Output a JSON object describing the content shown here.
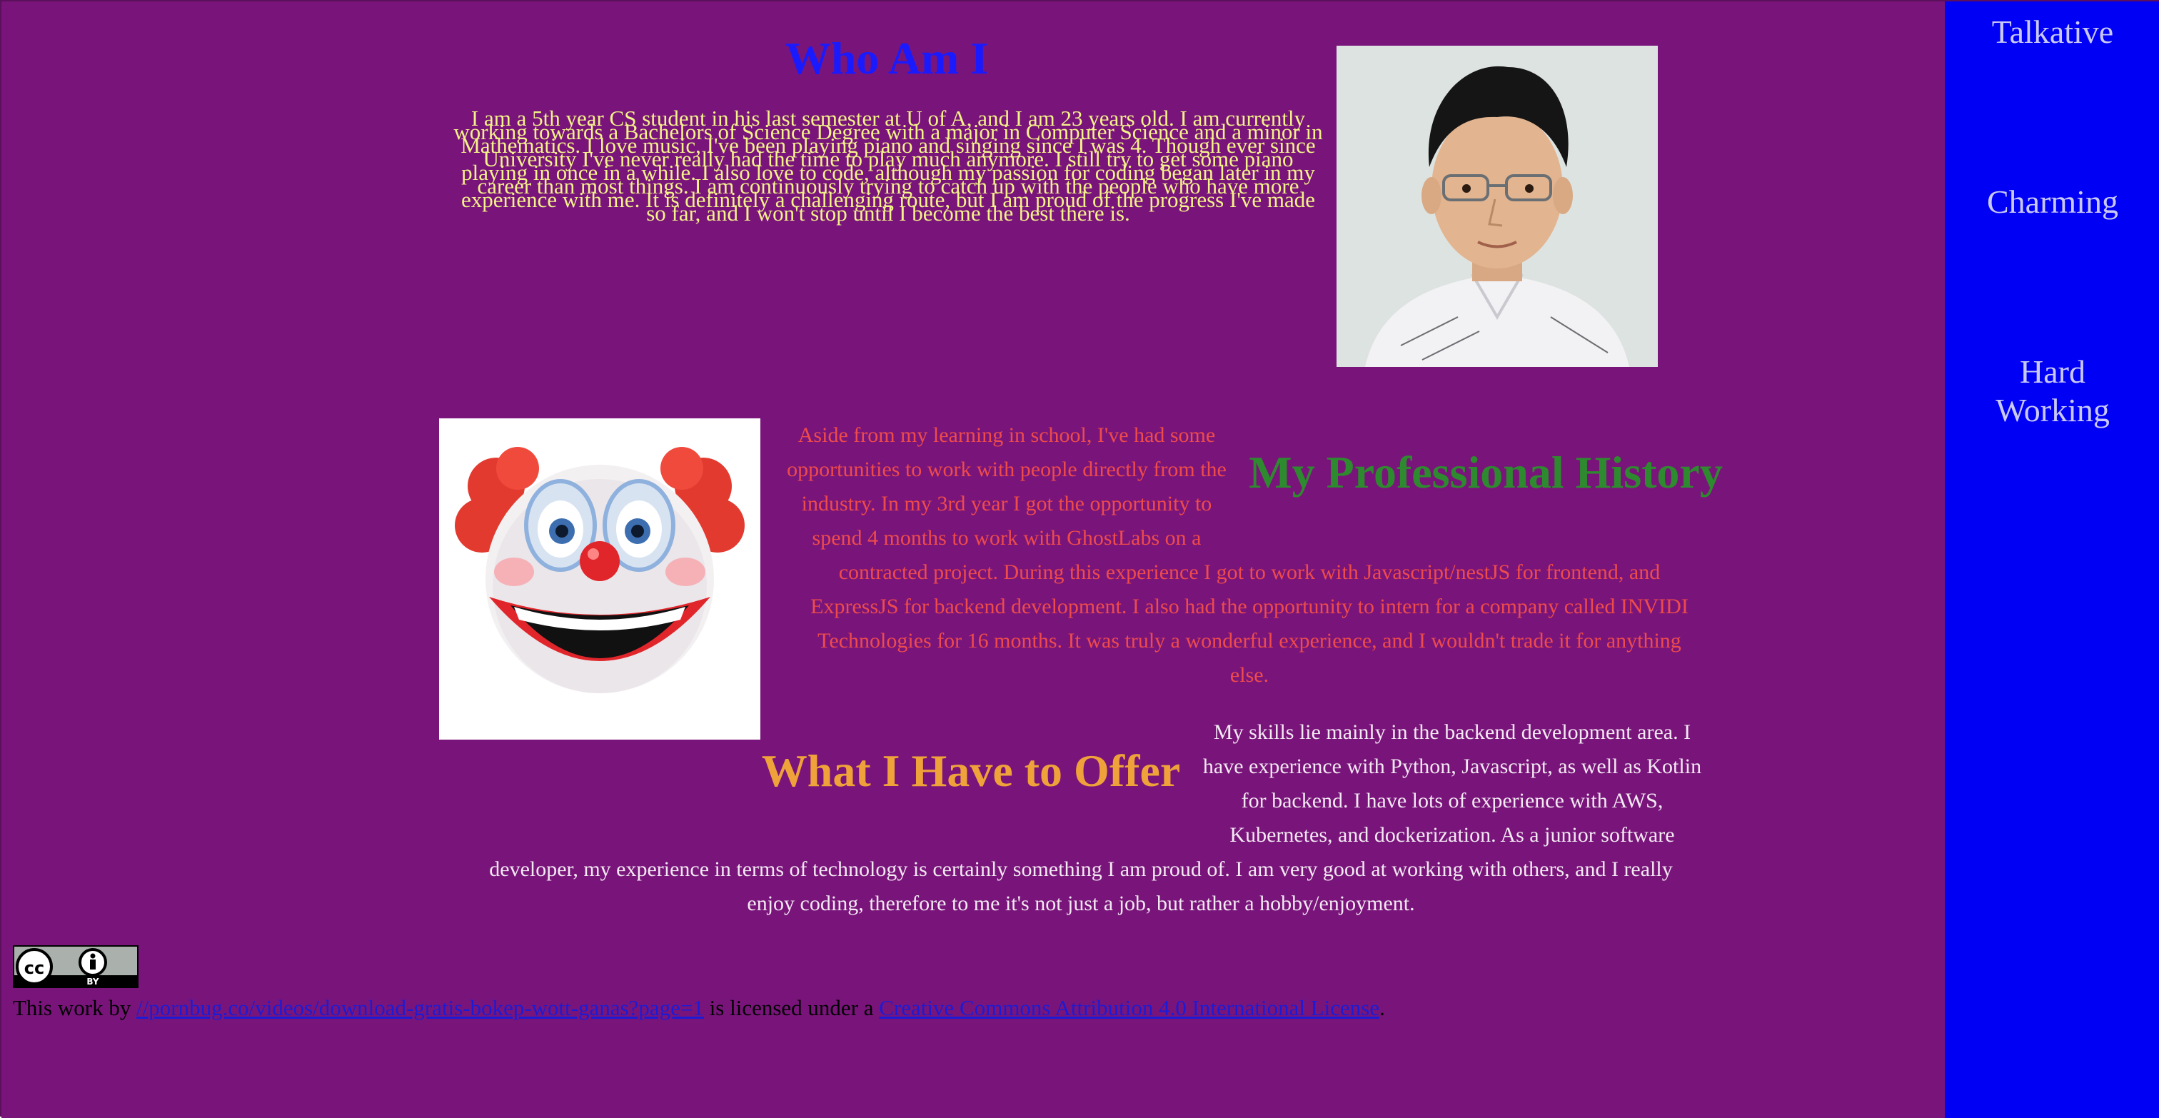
{
  "who_am_i": {
    "title": "Who Am I",
    "paragraph": "I am a 5th year CS student in his last semester at U of A, and I am 23 years old. I am currently working towards a Bachelors of Science Degree with a major in Computer Science and a minor in Mathematics. I love music, I've been playing piano and singing since I was 4. Though ever since University I've never really had the time to play much anymore. I still try to get some piano playing in once in a while. I also love to code, although my passion for coding began later in my career than most things. I am continuously trying to catch up with the people who have more experience with me. It is definitely a challenging route, but I am proud of the progress I've made so far, and I won't stop until I become the best there is.",
    "lines": [
      "I am a 5th year CS student in his last semester at U of A, and I am 23 years old. I am currently",
      "working towards a Bachelors of Science Degree with a major in Computer Science and a minor in",
      "Mathematics. I love music, I've been playing piano and singing since I was 4. Though ever since",
      "University I've never really had the time to play much anymore. I still try to get some piano",
      "playing in once in a while. I also love to code, although my passion for coding began later in my",
      "career than most things. I am continuously trying to catch up with the people who have more",
      "experience with me. It is definitely a challenging route, but I am proud of the progress I've made",
      "so far, and I won't stop until I become the best there is."
    ]
  },
  "professional_history": {
    "title": "My Professional History",
    "lines": [
      "Aside from my learning in school, I've had some",
      "opportunities to work with people directly from the",
      "industry. In my 3rd year I got the opportunity to",
      "spend 4 months to work with GhostLabs on a",
      "contracted project. During this experience I got to work with Javascript/nestJS for frontend, and",
      "ExpressJS for backend development. I also had the opportunity to intern for a company called INVIDI",
      "Technologies for 16 months. It was truly a wonderful experience, and I wouldn't trade it for anything",
      "else."
    ]
  },
  "offer": {
    "title": "What I Have to Offer",
    "lines": [
      "My skills lie mainly in the backend development area. I",
      "have experience with Python, Javascript, as well as Kotlin",
      "for backend. I have lots of experience with AWS,",
      "Kubernetes, and dockerization. As a junior software",
      "developer, my experience in terms of technology is certainly something I am proud of. I am very good at working with others, and I really",
      "enjoy coding, therefore to me it's not just a job, but rather a hobby/enjoyment."
    ]
  },
  "sidebar": {
    "items": [
      {
        "label": "Talkative"
      },
      {
        "label": "Charming"
      },
      {
        "label": "Hard Working",
        "line1": "Hard",
        "line2": "Working"
      }
    ]
  },
  "footer": {
    "badge_icon": "cc-by-icon",
    "badge_text": "BY",
    "prefix": "This work by ",
    "author_link": "//pornbug.co/videos/download-gratis-bokep-wott-ganas?page=1",
    "middle": " is licensed under a ",
    "license_link": "Creative Commons Attribution 4.0 International License",
    "suffix": "."
  },
  "colors": {
    "background": "#79157a",
    "sidebar": "#0000f5",
    "who_title": "#1a1aff",
    "who_text": "#f4f28a",
    "prof_title": "#2e8a2e",
    "prof_text": "#ee4b4b",
    "offer_title": "#f0a23a",
    "offer_text": "#f3e9f3",
    "link": "#1b1bd6"
  }
}
